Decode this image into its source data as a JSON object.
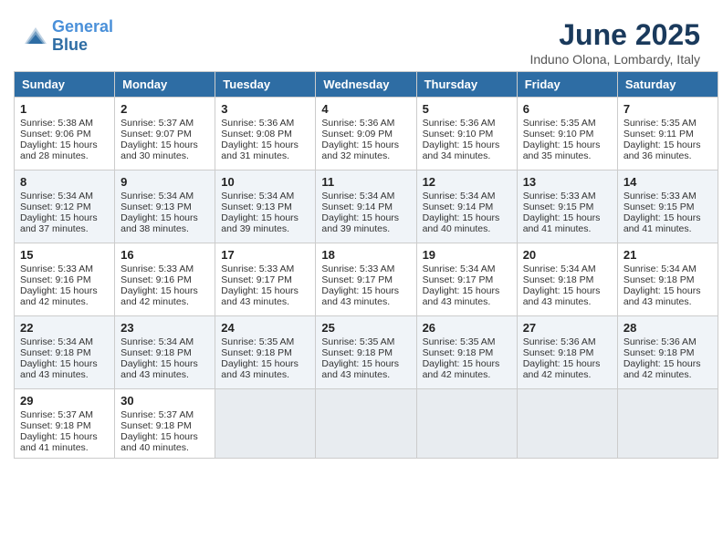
{
  "logo": {
    "line1": "General",
    "line2": "Blue"
  },
  "title": "June 2025",
  "location": "Induno Olona, Lombardy, Italy",
  "headers": [
    "Sunday",
    "Monday",
    "Tuesday",
    "Wednesday",
    "Thursday",
    "Friday",
    "Saturday"
  ],
  "weeks": [
    [
      {
        "day": "1",
        "sunrise": "Sunrise: 5:38 AM",
        "sunset": "Sunset: 9:06 PM",
        "daylight": "Daylight: 15 hours and 28 minutes."
      },
      {
        "day": "2",
        "sunrise": "Sunrise: 5:37 AM",
        "sunset": "Sunset: 9:07 PM",
        "daylight": "Daylight: 15 hours and 30 minutes."
      },
      {
        "day": "3",
        "sunrise": "Sunrise: 5:36 AM",
        "sunset": "Sunset: 9:08 PM",
        "daylight": "Daylight: 15 hours and 31 minutes."
      },
      {
        "day": "4",
        "sunrise": "Sunrise: 5:36 AM",
        "sunset": "Sunset: 9:09 PM",
        "daylight": "Daylight: 15 hours and 32 minutes."
      },
      {
        "day": "5",
        "sunrise": "Sunrise: 5:36 AM",
        "sunset": "Sunset: 9:10 PM",
        "daylight": "Daylight: 15 hours and 34 minutes."
      },
      {
        "day": "6",
        "sunrise": "Sunrise: 5:35 AM",
        "sunset": "Sunset: 9:10 PM",
        "daylight": "Daylight: 15 hours and 35 minutes."
      },
      {
        "day": "7",
        "sunrise": "Sunrise: 5:35 AM",
        "sunset": "Sunset: 9:11 PM",
        "daylight": "Daylight: 15 hours and 36 minutes."
      }
    ],
    [
      {
        "day": "8",
        "sunrise": "Sunrise: 5:34 AM",
        "sunset": "Sunset: 9:12 PM",
        "daylight": "Daylight: 15 hours and 37 minutes."
      },
      {
        "day": "9",
        "sunrise": "Sunrise: 5:34 AM",
        "sunset": "Sunset: 9:13 PM",
        "daylight": "Daylight: 15 hours and 38 minutes."
      },
      {
        "day": "10",
        "sunrise": "Sunrise: 5:34 AM",
        "sunset": "Sunset: 9:13 PM",
        "daylight": "Daylight: 15 hours and 39 minutes."
      },
      {
        "day": "11",
        "sunrise": "Sunrise: 5:34 AM",
        "sunset": "Sunset: 9:14 PM",
        "daylight": "Daylight: 15 hours and 39 minutes."
      },
      {
        "day": "12",
        "sunrise": "Sunrise: 5:34 AM",
        "sunset": "Sunset: 9:14 PM",
        "daylight": "Daylight: 15 hours and 40 minutes."
      },
      {
        "day": "13",
        "sunrise": "Sunrise: 5:33 AM",
        "sunset": "Sunset: 9:15 PM",
        "daylight": "Daylight: 15 hours and 41 minutes."
      },
      {
        "day": "14",
        "sunrise": "Sunrise: 5:33 AM",
        "sunset": "Sunset: 9:15 PM",
        "daylight": "Daylight: 15 hours and 41 minutes."
      }
    ],
    [
      {
        "day": "15",
        "sunrise": "Sunrise: 5:33 AM",
        "sunset": "Sunset: 9:16 PM",
        "daylight": "Daylight: 15 hours and 42 minutes."
      },
      {
        "day": "16",
        "sunrise": "Sunrise: 5:33 AM",
        "sunset": "Sunset: 9:16 PM",
        "daylight": "Daylight: 15 hours and 42 minutes."
      },
      {
        "day": "17",
        "sunrise": "Sunrise: 5:33 AM",
        "sunset": "Sunset: 9:17 PM",
        "daylight": "Daylight: 15 hours and 43 minutes."
      },
      {
        "day": "18",
        "sunrise": "Sunrise: 5:33 AM",
        "sunset": "Sunset: 9:17 PM",
        "daylight": "Daylight: 15 hours and 43 minutes."
      },
      {
        "day": "19",
        "sunrise": "Sunrise: 5:34 AM",
        "sunset": "Sunset: 9:17 PM",
        "daylight": "Daylight: 15 hours and 43 minutes."
      },
      {
        "day": "20",
        "sunrise": "Sunrise: 5:34 AM",
        "sunset": "Sunset: 9:18 PM",
        "daylight": "Daylight: 15 hours and 43 minutes."
      },
      {
        "day": "21",
        "sunrise": "Sunrise: 5:34 AM",
        "sunset": "Sunset: 9:18 PM",
        "daylight": "Daylight: 15 hours and 43 minutes."
      }
    ],
    [
      {
        "day": "22",
        "sunrise": "Sunrise: 5:34 AM",
        "sunset": "Sunset: 9:18 PM",
        "daylight": "Daylight: 15 hours and 43 minutes."
      },
      {
        "day": "23",
        "sunrise": "Sunrise: 5:34 AM",
        "sunset": "Sunset: 9:18 PM",
        "daylight": "Daylight: 15 hours and 43 minutes."
      },
      {
        "day": "24",
        "sunrise": "Sunrise: 5:35 AM",
        "sunset": "Sunset: 9:18 PM",
        "daylight": "Daylight: 15 hours and 43 minutes."
      },
      {
        "day": "25",
        "sunrise": "Sunrise: 5:35 AM",
        "sunset": "Sunset: 9:18 PM",
        "daylight": "Daylight: 15 hours and 43 minutes."
      },
      {
        "day": "26",
        "sunrise": "Sunrise: 5:35 AM",
        "sunset": "Sunset: 9:18 PM",
        "daylight": "Daylight: 15 hours and 42 minutes."
      },
      {
        "day": "27",
        "sunrise": "Sunrise: 5:36 AM",
        "sunset": "Sunset: 9:18 PM",
        "daylight": "Daylight: 15 hours and 42 minutes."
      },
      {
        "day": "28",
        "sunrise": "Sunrise: 5:36 AM",
        "sunset": "Sunset: 9:18 PM",
        "daylight": "Daylight: 15 hours and 42 minutes."
      }
    ],
    [
      {
        "day": "29",
        "sunrise": "Sunrise: 5:37 AM",
        "sunset": "Sunset: 9:18 PM",
        "daylight": "Daylight: 15 hours and 41 minutes."
      },
      {
        "day": "30",
        "sunrise": "Sunrise: 5:37 AM",
        "sunset": "Sunset: 9:18 PM",
        "daylight": "Daylight: 15 hours and 40 minutes."
      },
      null,
      null,
      null,
      null,
      null
    ]
  ]
}
